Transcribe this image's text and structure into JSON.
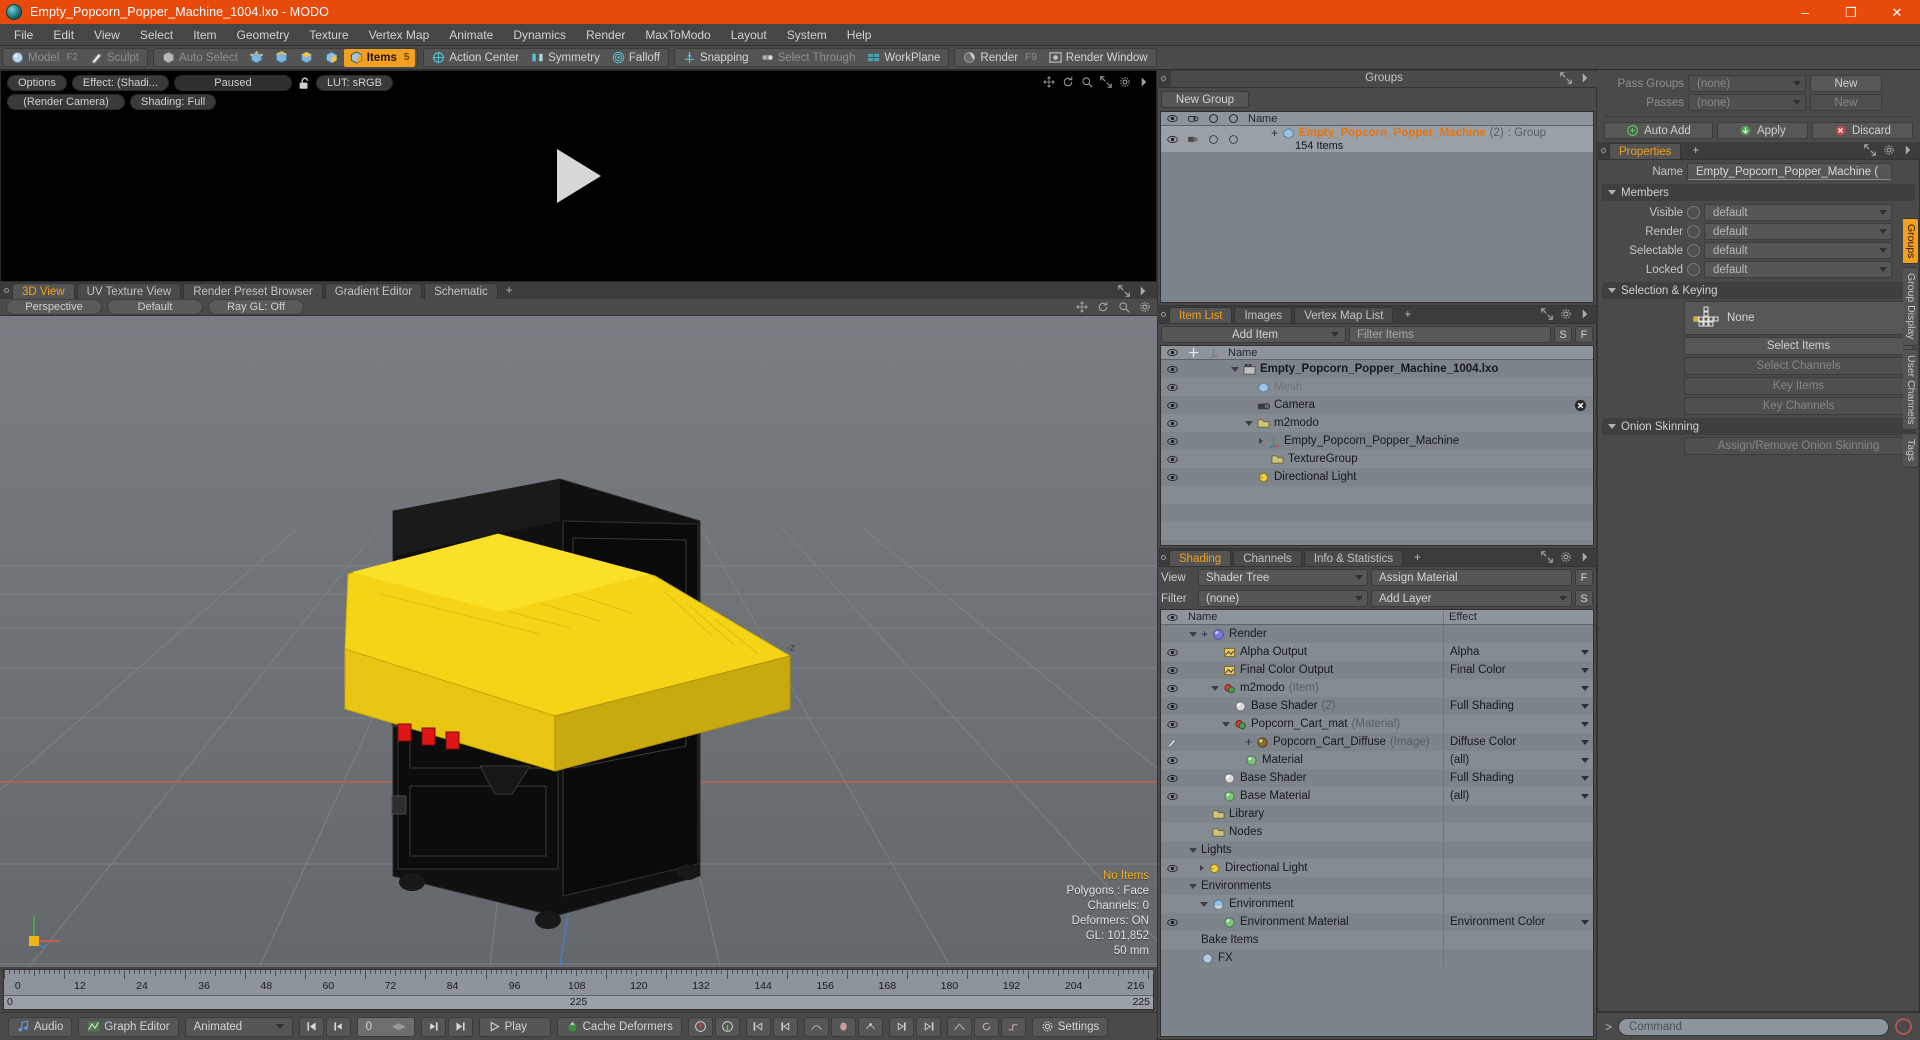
{
  "titlebar": {
    "title": "Empty_Popcorn_Popper_Machine_1004.lxo - MODO",
    "minimize": "–",
    "maximize": "❐",
    "close": "✕"
  },
  "menubar": {
    "items": [
      "File",
      "Edit",
      "View",
      "Select",
      "Item",
      "Geometry",
      "Texture",
      "Vertex Map",
      "Animate",
      "Dynamics",
      "Render",
      "MaxToModo",
      "Layout",
      "System",
      "Help"
    ]
  },
  "toolbar": {
    "group1": [
      {
        "label": "Model",
        "shortcut": "F2",
        "icon": "sphere-icon",
        "state": "dim"
      },
      {
        "label": "Sculpt",
        "shortcut": "",
        "icon": "brush-icon",
        "state": "dim"
      }
    ],
    "group2": [
      {
        "label": "Auto Select",
        "icon": "cube-icon",
        "state": "dim"
      },
      {
        "label": "",
        "icon": "vertex-mode-icon",
        "state": "normal"
      },
      {
        "label": "",
        "icon": "edge-mode-icon",
        "state": "normal"
      },
      {
        "label": "",
        "icon": "polygon-mode-icon",
        "state": "normal"
      },
      {
        "label": "",
        "icon": "material-mode-icon",
        "state": "normal"
      },
      {
        "label": "Items",
        "shortcut": "5",
        "icon": "items-mode-icon",
        "state": "active"
      }
    ],
    "group3": [
      {
        "label": "Action Center",
        "icon": "action-center-icon",
        "state": "normal"
      },
      {
        "label": "Symmetry",
        "icon": "symmetry-icon",
        "state": "normal"
      },
      {
        "label": "Falloff",
        "icon": "falloff-icon",
        "state": "normal"
      }
    ],
    "group4": [
      {
        "label": "Snapping",
        "icon": "snapping-icon",
        "state": "normal"
      },
      {
        "label": "Select Through",
        "icon": "select-through-icon",
        "state": "dim"
      },
      {
        "label": "WorkPlane",
        "icon": "workplane-icon",
        "state": "normal"
      }
    ],
    "group5": [
      {
        "label": "Render",
        "shortcut": "F9",
        "icon": "render-icon",
        "state": "normal"
      },
      {
        "label": "Render Window",
        "icon": "render-window-icon",
        "state": "normal"
      }
    ]
  },
  "render_pane": {
    "options_label": "Options",
    "effect_label": "Effect: (Shadi...",
    "paused_label": "Paused",
    "lock_icon": "unlocked-padlock-icon",
    "lut_label": "LUT: sRGB",
    "camera_label": "(Render Camera)",
    "shading_label": "Shading: Full",
    "play_icon": "play-triangle-icon"
  },
  "viewport": {
    "tabs": [
      {
        "label": "3D View",
        "selected": true
      },
      {
        "label": "UV Texture View",
        "selected": false
      },
      {
        "label": "Render Preset Browser",
        "selected": false
      },
      {
        "label": "Gradient Editor",
        "selected": false
      },
      {
        "label": "Schematic",
        "selected": false
      },
      {
        "label": "+",
        "selected": false
      }
    ],
    "controls": [
      {
        "label": "Perspective"
      },
      {
        "label": "Default"
      },
      {
        "label": "Ray GL: Off"
      }
    ],
    "stats": {
      "selection": "No Items",
      "polygons": "Polygons : Face",
      "channels": "Channels: 0",
      "deformers": "Deformers: ON",
      "gl": "GL: 101,852",
      "scale": "50 mm"
    },
    "axis_label_z": "-z"
  },
  "timeline": {
    "ticks": [
      "0",
      "12",
      "24",
      "36",
      "48",
      "60",
      "72",
      "84",
      "96",
      "108",
      "120",
      "132",
      "144",
      "156",
      "168",
      "180",
      "192",
      "204",
      "216"
    ],
    "range_start": "0",
    "range_center": "225",
    "range_end": "225"
  },
  "playbar": {
    "audio": "Audio",
    "graph_editor": "Graph Editor",
    "animated": "Animated",
    "frame_value": "0",
    "play": "Play",
    "cache_deformers": "Cache Deformers",
    "settings": "Settings",
    "icons": {
      "audio": "music-note-icon",
      "graph": "graph-icon",
      "go_start": "skip-to-start-icon",
      "step_back": "step-back-icon",
      "step_fwd": "step-forward-icon",
      "go_end": "skip-to-end-icon",
      "play": "play-icon",
      "cache": "cache-deformers-icon",
      "gear": "gear-icon"
    }
  },
  "groups_panel": {
    "title": "Groups",
    "new_group": "New Group",
    "columns": [
      "Name"
    ],
    "rows": [
      {
        "name": "Empty_Popcorn_Popper_Machine",
        "count": "(2)",
        "type": ": Group",
        "sub": "154 Items"
      }
    ]
  },
  "item_list_panel": {
    "tabs": [
      {
        "label": "Item List",
        "selected": true
      },
      {
        "label": "Images",
        "selected": false
      },
      {
        "label": "Vertex Map List",
        "selected": false
      },
      {
        "label": "+",
        "selected": false
      }
    ],
    "add_item": "Add Item",
    "filter_placeholder": "Filter Items",
    "btn_s": "S",
    "btn_f": "F",
    "name_header": "Name",
    "rows": [
      {
        "label": "Empty_Popcorn_Popper_Machine_1004.lxo",
        "indent": 0,
        "icon": "scene-icon",
        "bold": true,
        "gray": false,
        "expander": "open"
      },
      {
        "label": "Mesh",
        "indent": 1,
        "icon": "mesh-icon",
        "bold": false,
        "gray": true,
        "expander": ""
      },
      {
        "label": "Camera",
        "indent": 1,
        "icon": "camera-icon",
        "bold": false,
        "gray": false,
        "expander": "",
        "badge": "close-icon"
      },
      {
        "label": "m2modo",
        "indent": 1,
        "icon": "folder-icon",
        "bold": false,
        "gray": false,
        "expander": "open"
      },
      {
        "label": "Empty_Popcorn_Popper_Machine",
        "indent": 2,
        "icon": "locator-icon",
        "bold": false,
        "gray": false,
        "expander": "closed"
      },
      {
        "label": "TextureGroup",
        "indent": 2,
        "icon": "folder-icon",
        "bold": false,
        "gray": false,
        "expander": ""
      },
      {
        "label": "Directional Light",
        "indent": 1,
        "icon": "light-icon",
        "bold": false,
        "gray": false,
        "expander": ""
      }
    ]
  },
  "shading_panel": {
    "tabs": [
      {
        "label": "Shading",
        "selected": true
      },
      {
        "label": "Channels",
        "selected": false
      },
      {
        "label": "Info & Statistics",
        "selected": false
      },
      {
        "label": "+",
        "selected": false
      }
    ],
    "view_label": "View",
    "view_value": "Shader Tree",
    "assign_material": "Assign Material",
    "btn_f": "F",
    "filter_label": "Filter",
    "filter_value": "(none)",
    "add_layer": "Add Layer",
    "btn_s": "S",
    "col_name": "Name",
    "col_effect": "Effect",
    "rows": [
      {
        "label": "Render",
        "sub": "",
        "indent": 0,
        "icon": "render-sphere-icon",
        "effect": "",
        "eye": false,
        "expander": "open",
        "plus": true
      },
      {
        "label": "Alpha Output",
        "sub": "",
        "indent": 2,
        "icon": "output-icon",
        "effect": "Alpha",
        "eye": true,
        "expander": ""
      },
      {
        "label": "Final Color Output",
        "sub": "",
        "indent": 2,
        "icon": "output-icon",
        "effect": "Final Color",
        "eye": true,
        "expander": ""
      },
      {
        "label": "m2modo",
        "sub": "(Item)",
        "indent": 2,
        "icon": "item-mask-icon",
        "effect": "",
        "eye": true,
        "expander": "open"
      },
      {
        "label": "Base Shader",
        "sub": "(2)",
        "indent": 3,
        "icon": "shader-icon",
        "effect": "Full Shading",
        "eye": true,
        "expander": ""
      },
      {
        "label": "Popcorn_Cart_mat",
        "sub": "(Material)",
        "indent": 3,
        "icon": "item-mask-icon",
        "effect": "",
        "eye": true,
        "expander": "open"
      },
      {
        "label": "Popcorn_Cart_Diffuse",
        "sub": "(Image)",
        "indent": 4,
        "icon": "image-icon",
        "effect": "Diffuse Color",
        "eye": false,
        "brush": true,
        "expander": "",
        "plus": true
      },
      {
        "label": "Material",
        "sub": "",
        "indent": 4,
        "icon": "material-sphere-icon",
        "effect": "(all)",
        "eye": true,
        "expander": ""
      },
      {
        "label": "Base Shader",
        "sub": "",
        "indent": 2,
        "icon": "shader-icon",
        "effect": "Full Shading",
        "eye": true,
        "expander": ""
      },
      {
        "label": "Base Material",
        "sub": "",
        "indent": 2,
        "icon": "material-sphere-icon",
        "effect": "(all)",
        "eye": true,
        "expander": ""
      },
      {
        "label": "Library",
        "sub": "",
        "indent": 1,
        "icon": "folder-icon",
        "effect": "",
        "eye": false,
        "expander": ""
      },
      {
        "label": "Nodes",
        "sub": "",
        "indent": 1,
        "icon": "folder-icon",
        "effect": "",
        "eye": false,
        "expander": ""
      },
      {
        "label": "Lights",
        "sub": "",
        "indent": 0,
        "icon": "",
        "effect": "",
        "eye": false,
        "expander": "open"
      },
      {
        "label": "Directional Light",
        "sub": "",
        "indent": 1,
        "icon": "light-icon",
        "effect": "",
        "eye": true,
        "expander": "closed"
      },
      {
        "label": "Environments",
        "sub": "",
        "indent": 0,
        "icon": "",
        "effect": "",
        "eye": false,
        "expander": "open"
      },
      {
        "label": "Environment",
        "sub": "",
        "indent": 1,
        "icon": "environment-icon",
        "effect": "",
        "eye": false,
        "expander": "open"
      },
      {
        "label": "Environment Material",
        "sub": "",
        "indent": 2,
        "icon": "material-sphere-icon",
        "effect": "Environment Color",
        "eye": true,
        "expander": ""
      },
      {
        "label": "Bake Items",
        "sub": "",
        "indent": 0,
        "icon": "",
        "effect": "",
        "eye": false,
        "expander": ""
      },
      {
        "label": "FX",
        "sub": "",
        "indent": 0,
        "icon": "fx-icon",
        "effect": "",
        "eye": false,
        "expander": ""
      }
    ]
  },
  "properties_panel": {
    "pass_groups_label": "Pass Groups",
    "pass_groups_value": "(none)",
    "pass_groups_new": "New",
    "passes_label": "Passes",
    "passes_value": "(none)",
    "passes_new": "New",
    "auto_add": "Auto Add",
    "apply": "Apply",
    "discard": "Discard",
    "tab_properties": "Properties",
    "tab_plus": "+",
    "name_label": "Name",
    "name_value": "Empty_Popcorn_Popper_Machine (",
    "members_section": "Members",
    "members": [
      {
        "label": "Visible",
        "value": "default"
      },
      {
        "label": "Render",
        "value": "default"
      },
      {
        "label": "Selectable",
        "value": "default"
      },
      {
        "label": "Locked",
        "value": "default"
      }
    ],
    "selection_keying_section": "Selection & Keying",
    "none_value": "None",
    "select_items": "Select Items",
    "select_channels": "Select Channels",
    "key_items": "Key Items",
    "key_channels": "Key Channels",
    "onion_skinning_section": "Onion Skinning",
    "assign_remove_onion": "Assign/Remove Onion Skinning",
    "side_tabs": [
      {
        "label": "Groups",
        "selected": true
      },
      {
        "label": "Group Display",
        "selected": false
      },
      {
        "label": "User Channels",
        "selected": false
      },
      {
        "label": "Tags",
        "selected": false
      }
    ]
  },
  "command_bar": {
    "prompt": ">",
    "placeholder": "Command",
    "record_icon": "record-circle-icon"
  },
  "colors": {
    "accent": "#f2a021",
    "title_bar": "#e84a0c",
    "panel_bg": "#4a4a4a",
    "tree_bg": "#7d848c",
    "model_yellow": "#f5d316",
    "model_dark": "#0e0e0e"
  }
}
